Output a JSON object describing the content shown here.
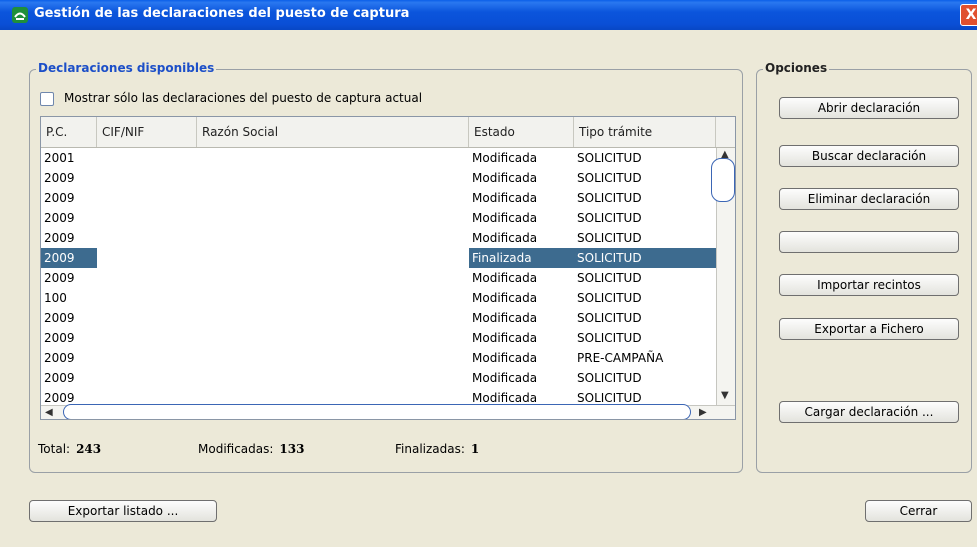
{
  "window": {
    "title": "Gestión de las declaraciones del puesto de captura",
    "close_label": "X"
  },
  "declaraciones": {
    "group_title": "Declaraciones disponibles",
    "checkbox_label": "Mostrar sólo las declaraciones del puesto de captura actual",
    "checkbox_checked": false,
    "columns": [
      "P.C.",
      "CIF/NIF",
      "Razón Social",
      "Estado",
      "Tipo trámite"
    ],
    "rows": [
      {
        "pc": "2001",
        "cif": "",
        "razon": "",
        "estado": "Modificada",
        "tipo": "SOLICITUD"
      },
      {
        "pc": "2009",
        "cif": "",
        "razon": "",
        "estado": "Modificada",
        "tipo": "SOLICITUD"
      },
      {
        "pc": "2009",
        "cif": "",
        "razon": "",
        "estado": "Modificada",
        "tipo": "SOLICITUD"
      },
      {
        "pc": "2009",
        "cif": "",
        "razon": "",
        "estado": "Modificada",
        "tipo": "SOLICITUD"
      },
      {
        "pc": "2009",
        "cif": "",
        "razon": "",
        "estado": "Modificada",
        "tipo": "SOLICITUD"
      },
      {
        "pc": "2009",
        "cif": "",
        "razon": "",
        "estado": "Finalizada",
        "tipo": "SOLICITUD"
      },
      {
        "pc": "2009",
        "cif": "",
        "razon": "",
        "estado": "Modificada",
        "tipo": "SOLICITUD"
      },
      {
        "pc": "100",
        "cif": "",
        "razon": "",
        "estado": "Modificada",
        "tipo": "SOLICITUD"
      },
      {
        "pc": "2009",
        "cif": "",
        "razon": "",
        "estado": "Modificada",
        "tipo": "SOLICITUD"
      },
      {
        "pc": "2009",
        "cif": "",
        "razon": "",
        "estado": "Modificada",
        "tipo": "SOLICITUD"
      },
      {
        "pc": "2009",
        "cif": "",
        "razon": "",
        "estado": "Modificada",
        "tipo": "PRE-CAMPAÑA"
      },
      {
        "pc": "2009",
        "cif": "",
        "razon": "",
        "estado": "Modificada",
        "tipo": "SOLICITUD"
      },
      {
        "pc": "2009",
        "cif": "",
        "razon": "",
        "estado": "Modificada",
        "tipo": "SOLICITUD"
      }
    ],
    "selected_row_index": 5,
    "totals": {
      "total_label": "Total:",
      "total_value": "243",
      "modificadas_label": "Modificadas:",
      "modificadas_value": "133",
      "finalizadas_label": "Finalizadas:",
      "finalizadas_value": "1"
    }
  },
  "opciones": {
    "group_title": "Opciones",
    "buttons": [
      "Abrir declaración",
      "Buscar declaración",
      "Eliminar declaración",
      "",
      "Importar recintos",
      "Exportar a Fichero",
      "Cargar declaración ..."
    ]
  },
  "footer": {
    "exportar_listado": "Exportar listado ...",
    "cerrar": "Cerrar"
  },
  "colors": {
    "titlebar": "#0a4fd6",
    "selection": "#3d6b8f",
    "group_title_blue": "#1c4fc8"
  }
}
